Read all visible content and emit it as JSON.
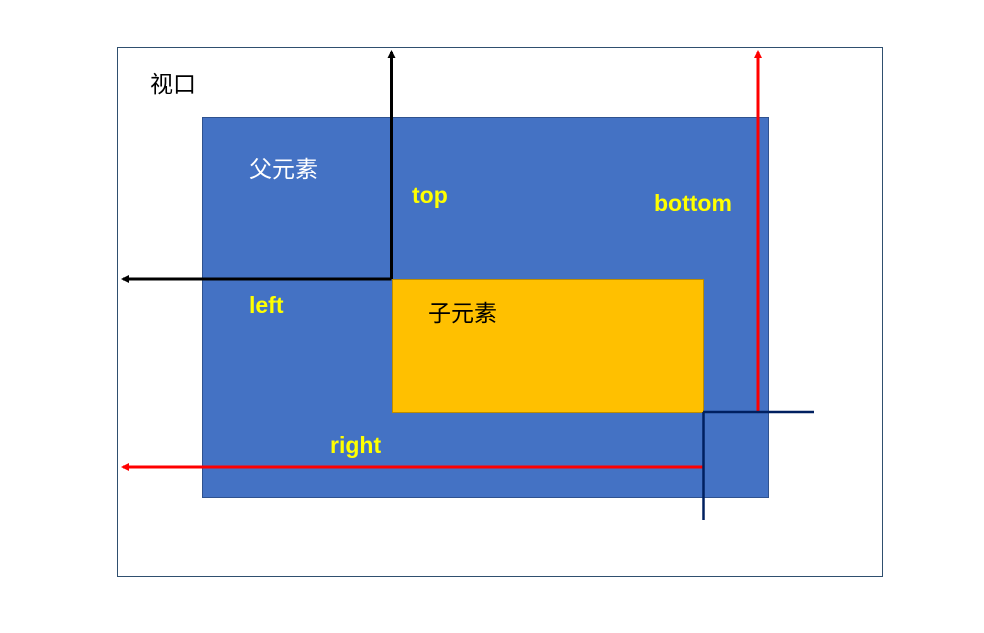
{
  "labels": {
    "viewport": "视口",
    "parent": "父元素",
    "child": "子元素",
    "top": "top",
    "bottom": "bottom",
    "left": "left",
    "right": "right"
  },
  "colors": {
    "parent_fill": "#4472c4",
    "child_fill": "#ffc000",
    "keyword_text": "#ffff00",
    "top_left_arrows": "#000000",
    "right_bottom_arrows": "#ff0000",
    "corner_marker": "#002060"
  }
}
